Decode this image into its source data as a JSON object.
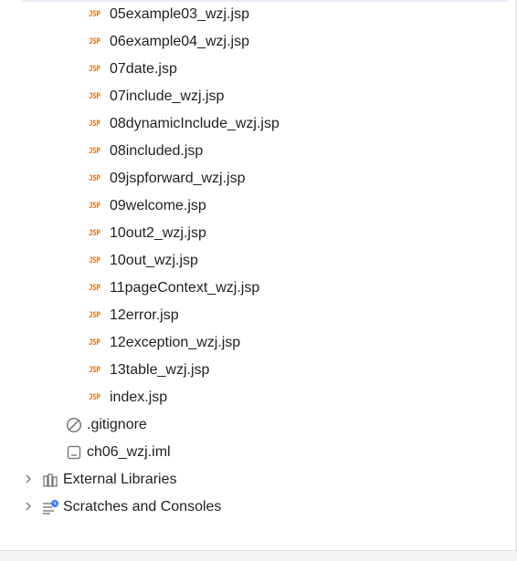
{
  "tree": {
    "jsp_files": [
      {
        "icon": "JSP",
        "label": "05example03_wzj.jsp"
      },
      {
        "icon": "JSP",
        "label": "06example04_wzj.jsp"
      },
      {
        "icon": "JSP",
        "label": "07date.jsp"
      },
      {
        "icon": "JSP",
        "label": "07include_wzj.jsp"
      },
      {
        "icon": "JSP",
        "label": "08dynamicInclude_wzj.jsp"
      },
      {
        "icon": "JSP",
        "label": "08included.jsp"
      },
      {
        "icon": "JSP",
        "label": "09jspforward_wzj.jsp"
      },
      {
        "icon": "JSP",
        "label": "09welcome.jsp"
      },
      {
        "icon": "JSP",
        "label": "10out2_wzj.jsp"
      },
      {
        "icon": "JSP",
        "label": "10out_wzj.jsp"
      },
      {
        "icon": "JSP",
        "label": "11pageContext_wzj.jsp"
      },
      {
        "icon": "JSP",
        "label": "12error.jsp"
      },
      {
        "icon": "JSP",
        "label": "12exception_wzj.jsp"
      },
      {
        "icon": "JSP",
        "label": "13table_wzj.jsp"
      },
      {
        "icon": "JSP",
        "label": "index.jsp"
      }
    ],
    "gitignore": {
      "label": ".gitignore",
      "icon": "ignored-file-icon"
    },
    "iml": {
      "label": "ch06_wzj.iml",
      "icon": "module-file-icon"
    },
    "external_libraries": {
      "label": "External Libraries",
      "icon": "library-icon",
      "expander": "chevron-right-icon"
    },
    "scratches": {
      "label": "Scratches and Consoles",
      "icon": "scratches-icon",
      "expander": "chevron-right-icon"
    }
  },
  "colors": {
    "jsp_icon": "#e0741a",
    "text": "#1f1f1f",
    "chevron": "#7a7a7a",
    "scratch_badge": "#3c7cf2"
  }
}
